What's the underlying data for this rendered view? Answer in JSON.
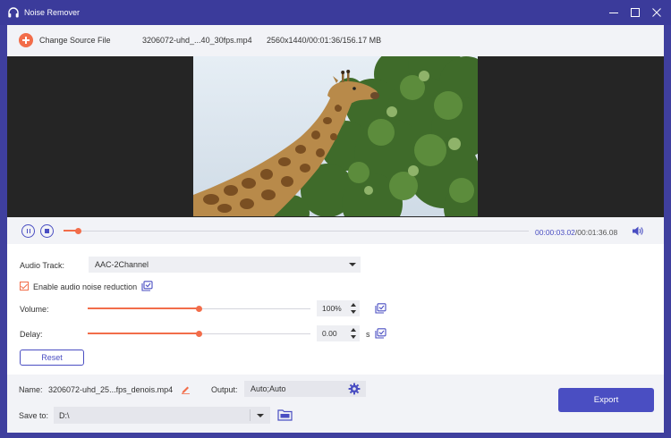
{
  "window": {
    "title": "Noise Remover",
    "icon": "headphones-icon"
  },
  "topbar": {
    "change_source_label": "Change Source File",
    "file_name": "3206072-uhd_...40_30fps.mp4",
    "file_info": "2560x1440/00:01:36/156.17 MB"
  },
  "playback": {
    "current_time": "00:00:03.02",
    "total_time": "/00:01:36.08",
    "progress_fraction": 0.031
  },
  "settings": {
    "audio_track_label": "Audio Track:",
    "audio_track_value": "AAC-2Channel",
    "noise_reduction_label": "Enable audio noise reduction",
    "noise_reduction_checked": true,
    "volume_label": "Volume:",
    "volume_value": "100%",
    "volume_fraction": 0.5,
    "delay_label": "Delay:",
    "delay_value": "0.00",
    "delay_unit": "s",
    "delay_fraction": 0.5,
    "reset_label": "Reset"
  },
  "bottom": {
    "name_label": "Name:",
    "name_value": "3206072-uhd_25...fps_denois.mp4",
    "output_label": "Output:",
    "output_value": "Auto;Auto",
    "save_to_label": "Save to:",
    "save_to_value": "D:\\",
    "export_label": "Export"
  },
  "colors": {
    "accent": "#4a4ec2",
    "orange": "#f26d4a",
    "titlebar": "#3b3b9b"
  }
}
